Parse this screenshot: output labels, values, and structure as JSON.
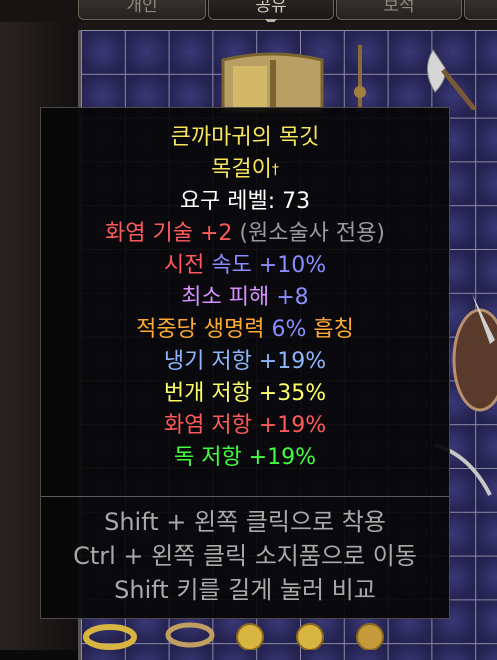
{
  "tabs": [
    {
      "label": "개인"
    },
    {
      "label": "공유"
    },
    {
      "label": "보석"
    }
  ],
  "tooltip": {
    "name": "큰까마귀의 목깃",
    "base": "목걸이",
    "base_mark": "†",
    "level_req": "요구 레벨: 73",
    "fire_skill_a": "화염 기술 +2",
    "fire_skill_b": " (원소술사 전용)",
    "ias_a": "시전 ",
    "ias_b": "속도 +10%",
    "min_dmg_a": "최소 피해 ",
    "min_dmg_b": "+8",
    "leech_a": "적중당 생명력 ",
    "leech_b": "6%",
    "leech_c": " 흡칭",
    "cold_res": "냉기 저항 +19%",
    "light_res": "번개 저항 +35%",
    "fire_res": "화염 저항 +19%",
    "poison_res": "독 저항 +19%",
    "hint_equip": "Shift + 왼쪽 클릭으로 착용",
    "hint_move": "Ctrl + 왼쪽 클릭 소지품으로 이동",
    "hint_compare": "Shift 키를 길게 눌러 비교"
  },
  "colors": {
    "unique_gold": "#f7e65a",
    "white": "#ffffff",
    "fire_red": "#ff5a5a",
    "gray": "#9a9a9a",
    "magic_blue": "#8a8cff",
    "purple": "#d890ff",
    "orange": "#ffaa33",
    "cold_blue": "#8db6ff",
    "light_yellow": "#ffff66",
    "poison_green": "#40ff40"
  }
}
